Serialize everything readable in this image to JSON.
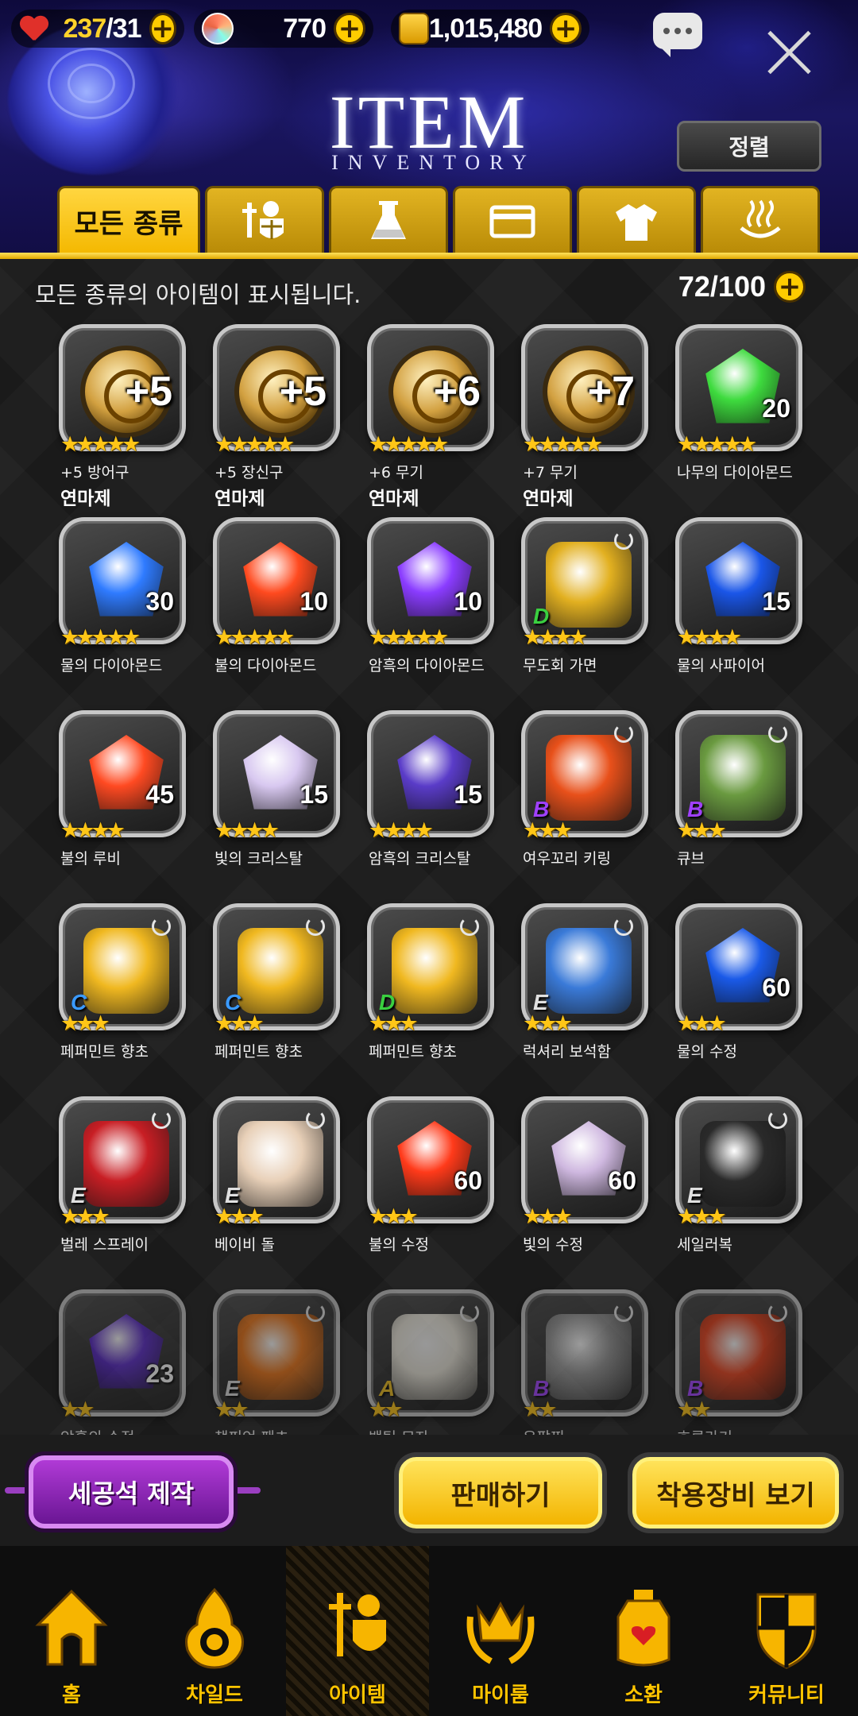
{
  "resources": {
    "stamina_current": "237",
    "stamina_max": "/31",
    "gems": "770",
    "gold": "1,015,480"
  },
  "header": {
    "title": "ITEM",
    "subtitle": "INVENTORY",
    "sort_label": "정렬"
  },
  "tabs": [
    {
      "label": "모든 종류",
      "icon": "all",
      "active": true
    },
    {
      "label": "",
      "icon": "armor-icon",
      "active": false
    },
    {
      "label": "",
      "icon": "flask-icon",
      "active": false
    },
    {
      "label": "",
      "icon": "card-icon",
      "active": false
    },
    {
      "label": "",
      "icon": "shirt-icon",
      "active": false
    },
    {
      "label": "",
      "icon": "hot-spring-icon",
      "active": false
    }
  ],
  "inventory": {
    "info": "모든 종류의 아이템이 표시됩니다.",
    "capacity": "72/100",
    "items": [
      {
        "name": "+5 방어구",
        "sub": "연마제",
        "stars": "★★★★★",
        "plus": "+5",
        "count": "",
        "grade": "",
        "kind": "medal",
        "color": "#d4a040"
      },
      {
        "name": "+5 장신구",
        "sub": "연마제",
        "stars": "★★★★★",
        "plus": "+5",
        "count": "",
        "grade": "",
        "kind": "medal",
        "color": "#d4a040"
      },
      {
        "name": "+6 무기",
        "sub": "연마제",
        "stars": "★★★★★",
        "plus": "+6",
        "count": "",
        "grade": "",
        "kind": "medal",
        "color": "#d4a040"
      },
      {
        "name": "+7 무기",
        "sub": "연마제",
        "stars": "★★★★★",
        "plus": "+7",
        "count": "",
        "grade": "",
        "kind": "medal",
        "color": "#d4a040"
      },
      {
        "name": "나무의 다이아몬드",
        "sub": "",
        "stars": "★★★★★",
        "plus": "",
        "count": "20",
        "grade": "",
        "kind": "gem",
        "color": "#3edb3e"
      },
      {
        "name": "물의 다이아몬드",
        "sub": "",
        "stars": "★★★★★",
        "plus": "",
        "count": "30",
        "grade": "",
        "kind": "gem",
        "color": "#2f7bff"
      },
      {
        "name": "불의 다이아몬드",
        "sub": "",
        "stars": "★★★★★",
        "plus": "",
        "count": "10",
        "grade": "",
        "kind": "gem",
        "color": "#ff4a1f"
      },
      {
        "name": "암흑의 다이아몬드",
        "sub": "",
        "stars": "★★★★★",
        "plus": "",
        "count": "10",
        "grade": "",
        "kind": "gem",
        "color": "#8a3cff"
      },
      {
        "name": "무도회 가면",
        "sub": "",
        "stars": "★★★★",
        "plus": "",
        "count": "",
        "grade": "D",
        "kind": "item",
        "color": "#e2b020"
      },
      {
        "name": "물의 사파이어",
        "sub": "",
        "stars": "★★★★",
        "plus": "",
        "count": "15",
        "grade": "",
        "kind": "gem",
        "color": "#1a56e8"
      },
      {
        "name": "불의 루비",
        "sub": "",
        "stars": "★★★★",
        "plus": "",
        "count": "45",
        "grade": "",
        "kind": "gem",
        "color": "#ff4a22"
      },
      {
        "name": "빛의 크리스탈",
        "sub": "",
        "stars": "★★★★",
        "plus": "",
        "count": "15",
        "grade": "",
        "kind": "gem",
        "color": "#d8c8f0"
      },
      {
        "name": "암흑의 크리스탈",
        "sub": "",
        "stars": "★★★★",
        "plus": "",
        "count": "15",
        "grade": "",
        "kind": "gem",
        "color": "#5a3cc8"
      },
      {
        "name": "여우꼬리 키링",
        "sub": "",
        "stars": "★★★",
        "plus": "",
        "count": "",
        "grade": "B",
        "kind": "item",
        "color": "#e8501a"
      },
      {
        "name": "큐브",
        "sub": "",
        "stars": "★★★",
        "plus": "",
        "count": "",
        "grade": "B",
        "kind": "item",
        "color": "#6a9a40"
      },
      {
        "name": "페퍼민트 향초",
        "sub": "",
        "stars": "★★★",
        "plus": "",
        "count": "",
        "grade": "C",
        "kind": "item",
        "color": "#f0b820"
      },
      {
        "name": "페퍼민트 향초",
        "sub": "",
        "stars": "★★★",
        "plus": "",
        "count": "",
        "grade": "C",
        "kind": "item",
        "color": "#f0b820"
      },
      {
        "name": "페퍼민트 향초",
        "sub": "",
        "stars": "★★★",
        "plus": "",
        "count": "",
        "grade": "D",
        "kind": "item",
        "color": "#f0b820"
      },
      {
        "name": "럭셔리 보석함",
        "sub": "",
        "stars": "★★★",
        "plus": "",
        "count": "",
        "grade": "E",
        "kind": "item",
        "color": "#3a7ad8"
      },
      {
        "name": "물의 수정",
        "sub": "",
        "stars": "★★★",
        "plus": "",
        "count": "60",
        "grade": "",
        "kind": "gem",
        "color": "#1a5ae8"
      },
      {
        "name": "벌레 스프레이",
        "sub": "",
        "stars": "★★★",
        "plus": "",
        "count": "",
        "grade": "E",
        "kind": "item",
        "color": "#c81e24"
      },
      {
        "name": "베이비 돌",
        "sub": "",
        "stars": "★★★",
        "plus": "",
        "count": "",
        "grade": "E",
        "kind": "item",
        "color": "#e8d0b8"
      },
      {
        "name": "불의 수정",
        "sub": "",
        "stars": "★★★",
        "plus": "",
        "count": "60",
        "grade": "",
        "kind": "gem",
        "color": "#ff3a1a"
      },
      {
        "name": "빛의 수정",
        "sub": "",
        "stars": "★★★",
        "plus": "",
        "count": "60",
        "grade": "",
        "kind": "gem",
        "color": "#cfb8e0"
      },
      {
        "name": "세일러복",
        "sub": "",
        "stars": "★★★",
        "plus": "",
        "count": "",
        "grade": "E",
        "kind": "item",
        "color": "#2a2a2a"
      },
      {
        "name": "암흑의 수정",
        "sub": "",
        "stars": "★★",
        "plus": "",
        "count": "23",
        "grade": "",
        "kind": "gem",
        "color": "#5a2ac8"
      },
      {
        "name": "챔피언 팬츠",
        "sub": "",
        "stars": "★★",
        "plus": "",
        "count": "",
        "grade": "E",
        "kind": "item",
        "color": "#f0781a"
      },
      {
        "name": "백팀 모자",
        "sub": "",
        "stars": "★★",
        "plus": "",
        "count": "",
        "grade": "A",
        "kind": "item",
        "color": "#f0ece0"
      },
      {
        "name": "은팔찌",
        "sub": "",
        "stars": "★★",
        "plus": "",
        "count": "",
        "grade": "B",
        "kind": "item",
        "color": "#9a9a9a"
      },
      {
        "name": "호루라기",
        "sub": "",
        "stars": "★★",
        "plus": "",
        "count": "",
        "grade": "B",
        "kind": "item",
        "color": "#e8401a"
      }
    ]
  },
  "actions": {
    "craft": "세공석 제작",
    "sell": "판매하기",
    "equipped": "착용장비 보기"
  },
  "nav": [
    {
      "label": "홈",
      "icon": "home-icon",
      "active": false
    },
    {
      "label": "차일드",
      "icon": "child-icon",
      "active": false
    },
    {
      "label": "아이템",
      "icon": "item-icon",
      "active": true
    },
    {
      "label": "마이룸",
      "icon": "myroom-icon",
      "active": false
    },
    {
      "label": "소환",
      "icon": "summon-icon",
      "active": false
    },
    {
      "label": "커뮤니티",
      "icon": "community-icon",
      "active": false
    }
  ],
  "colors": {
    "accent": "#ffc400",
    "grade_A": "#f0c020",
    "grade_B": "#a040ff",
    "grade_C": "#3a9aff",
    "grade_D": "#3ad040",
    "grade_E": "#e0e0e0"
  }
}
